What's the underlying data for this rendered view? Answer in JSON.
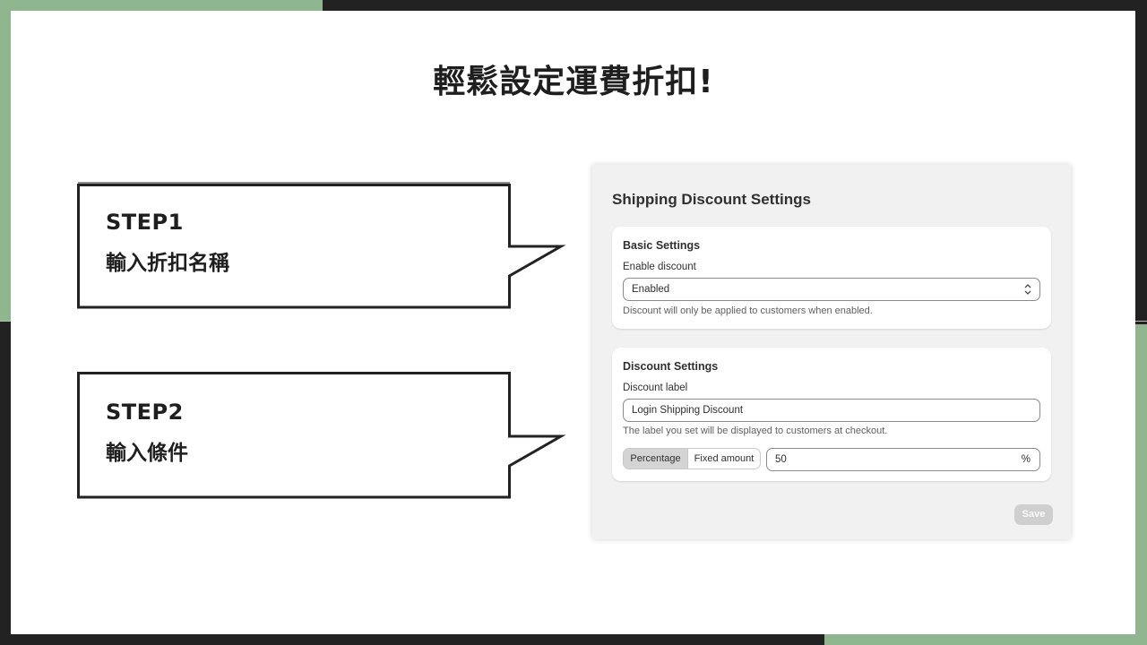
{
  "slide": {
    "title": "輕鬆設定運費折扣!"
  },
  "steps": [
    {
      "label": "STEP1",
      "description": "輸入折扣名稱"
    },
    {
      "label": "STEP2",
      "description": "輸入條件"
    }
  ],
  "panel": {
    "title": "Shipping Discount Settings",
    "basic_settings": {
      "title": "Basic Settings",
      "enable_label": "Enable discount",
      "enable_value": "Enabled",
      "help": "Discount will only be applied to customers when enabled."
    },
    "discount_settings": {
      "title": "Discount Settings",
      "label_field_label": "Discount label",
      "label_value": "Login Shipping Discount",
      "help": "The label you set will be displayed to customers at checkout.",
      "type_options": [
        "Percentage",
        "Fixed amount"
      ],
      "type_selected": "Percentage",
      "amount_value": "50",
      "amount_suffix": "%"
    },
    "save_label": "Save"
  },
  "colors": {
    "background_dark": "#222222",
    "accent_green": "#90b690",
    "panel_bg": "#f1f1f1",
    "text_dark": "#303030"
  }
}
